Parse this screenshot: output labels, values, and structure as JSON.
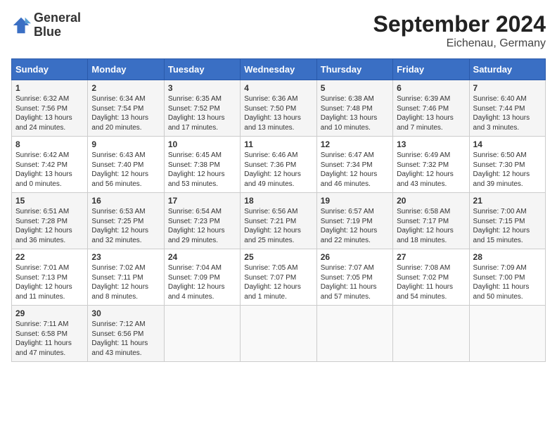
{
  "header": {
    "logo_line1": "General",
    "logo_line2": "Blue",
    "month_year": "September 2024",
    "location": "Eichenau, Germany"
  },
  "weekdays": [
    "Sunday",
    "Monday",
    "Tuesday",
    "Wednesday",
    "Thursday",
    "Friday",
    "Saturday"
  ],
  "weeks": [
    [
      {
        "day": "1",
        "sunrise": "Sunrise: 6:32 AM",
        "sunset": "Sunset: 7:56 PM",
        "daylight": "Daylight: 13 hours and 24 minutes."
      },
      {
        "day": "2",
        "sunrise": "Sunrise: 6:34 AM",
        "sunset": "Sunset: 7:54 PM",
        "daylight": "Daylight: 13 hours and 20 minutes."
      },
      {
        "day": "3",
        "sunrise": "Sunrise: 6:35 AM",
        "sunset": "Sunset: 7:52 PM",
        "daylight": "Daylight: 13 hours and 17 minutes."
      },
      {
        "day": "4",
        "sunrise": "Sunrise: 6:36 AM",
        "sunset": "Sunset: 7:50 PM",
        "daylight": "Daylight: 13 hours and 13 minutes."
      },
      {
        "day": "5",
        "sunrise": "Sunrise: 6:38 AM",
        "sunset": "Sunset: 7:48 PM",
        "daylight": "Daylight: 13 hours and 10 minutes."
      },
      {
        "day": "6",
        "sunrise": "Sunrise: 6:39 AM",
        "sunset": "Sunset: 7:46 PM",
        "daylight": "Daylight: 13 hours and 7 minutes."
      },
      {
        "day": "7",
        "sunrise": "Sunrise: 6:40 AM",
        "sunset": "Sunset: 7:44 PM",
        "daylight": "Daylight: 13 hours and 3 minutes."
      }
    ],
    [
      {
        "day": "8",
        "sunrise": "Sunrise: 6:42 AM",
        "sunset": "Sunset: 7:42 PM",
        "daylight": "Daylight: 13 hours and 0 minutes."
      },
      {
        "day": "9",
        "sunrise": "Sunrise: 6:43 AM",
        "sunset": "Sunset: 7:40 PM",
        "daylight": "Daylight: 12 hours and 56 minutes."
      },
      {
        "day": "10",
        "sunrise": "Sunrise: 6:45 AM",
        "sunset": "Sunset: 7:38 PM",
        "daylight": "Daylight: 12 hours and 53 minutes."
      },
      {
        "day": "11",
        "sunrise": "Sunrise: 6:46 AM",
        "sunset": "Sunset: 7:36 PM",
        "daylight": "Daylight: 12 hours and 49 minutes."
      },
      {
        "day": "12",
        "sunrise": "Sunrise: 6:47 AM",
        "sunset": "Sunset: 7:34 PM",
        "daylight": "Daylight: 12 hours and 46 minutes."
      },
      {
        "day": "13",
        "sunrise": "Sunrise: 6:49 AM",
        "sunset": "Sunset: 7:32 PM",
        "daylight": "Daylight: 12 hours and 43 minutes."
      },
      {
        "day": "14",
        "sunrise": "Sunrise: 6:50 AM",
        "sunset": "Sunset: 7:30 PM",
        "daylight": "Daylight: 12 hours and 39 minutes."
      }
    ],
    [
      {
        "day": "15",
        "sunrise": "Sunrise: 6:51 AM",
        "sunset": "Sunset: 7:28 PM",
        "daylight": "Daylight: 12 hours and 36 minutes."
      },
      {
        "day": "16",
        "sunrise": "Sunrise: 6:53 AM",
        "sunset": "Sunset: 7:25 PM",
        "daylight": "Daylight: 12 hours and 32 minutes."
      },
      {
        "day": "17",
        "sunrise": "Sunrise: 6:54 AM",
        "sunset": "Sunset: 7:23 PM",
        "daylight": "Daylight: 12 hours and 29 minutes."
      },
      {
        "day": "18",
        "sunrise": "Sunrise: 6:56 AM",
        "sunset": "Sunset: 7:21 PM",
        "daylight": "Daylight: 12 hours and 25 minutes."
      },
      {
        "day": "19",
        "sunrise": "Sunrise: 6:57 AM",
        "sunset": "Sunset: 7:19 PM",
        "daylight": "Daylight: 12 hours and 22 minutes."
      },
      {
        "day": "20",
        "sunrise": "Sunrise: 6:58 AM",
        "sunset": "Sunset: 7:17 PM",
        "daylight": "Daylight: 12 hours and 18 minutes."
      },
      {
        "day": "21",
        "sunrise": "Sunrise: 7:00 AM",
        "sunset": "Sunset: 7:15 PM",
        "daylight": "Daylight: 12 hours and 15 minutes."
      }
    ],
    [
      {
        "day": "22",
        "sunrise": "Sunrise: 7:01 AM",
        "sunset": "Sunset: 7:13 PM",
        "daylight": "Daylight: 12 hours and 11 minutes."
      },
      {
        "day": "23",
        "sunrise": "Sunrise: 7:02 AM",
        "sunset": "Sunset: 7:11 PM",
        "daylight": "Daylight: 12 hours and 8 minutes."
      },
      {
        "day": "24",
        "sunrise": "Sunrise: 7:04 AM",
        "sunset": "Sunset: 7:09 PM",
        "daylight": "Daylight: 12 hours and 4 minutes."
      },
      {
        "day": "25",
        "sunrise": "Sunrise: 7:05 AM",
        "sunset": "Sunset: 7:07 PM",
        "daylight": "Daylight: 12 hours and 1 minute."
      },
      {
        "day": "26",
        "sunrise": "Sunrise: 7:07 AM",
        "sunset": "Sunset: 7:05 PM",
        "daylight": "Daylight: 11 hours and 57 minutes."
      },
      {
        "day": "27",
        "sunrise": "Sunrise: 7:08 AM",
        "sunset": "Sunset: 7:02 PM",
        "daylight": "Daylight: 11 hours and 54 minutes."
      },
      {
        "day": "28",
        "sunrise": "Sunrise: 7:09 AM",
        "sunset": "Sunset: 7:00 PM",
        "daylight": "Daylight: 11 hours and 50 minutes."
      }
    ],
    [
      {
        "day": "29",
        "sunrise": "Sunrise: 7:11 AM",
        "sunset": "Sunset: 6:58 PM",
        "daylight": "Daylight: 11 hours and 47 minutes."
      },
      {
        "day": "30",
        "sunrise": "Sunrise: 7:12 AM",
        "sunset": "Sunset: 6:56 PM",
        "daylight": "Daylight: 11 hours and 43 minutes."
      },
      null,
      null,
      null,
      null,
      null
    ]
  ]
}
